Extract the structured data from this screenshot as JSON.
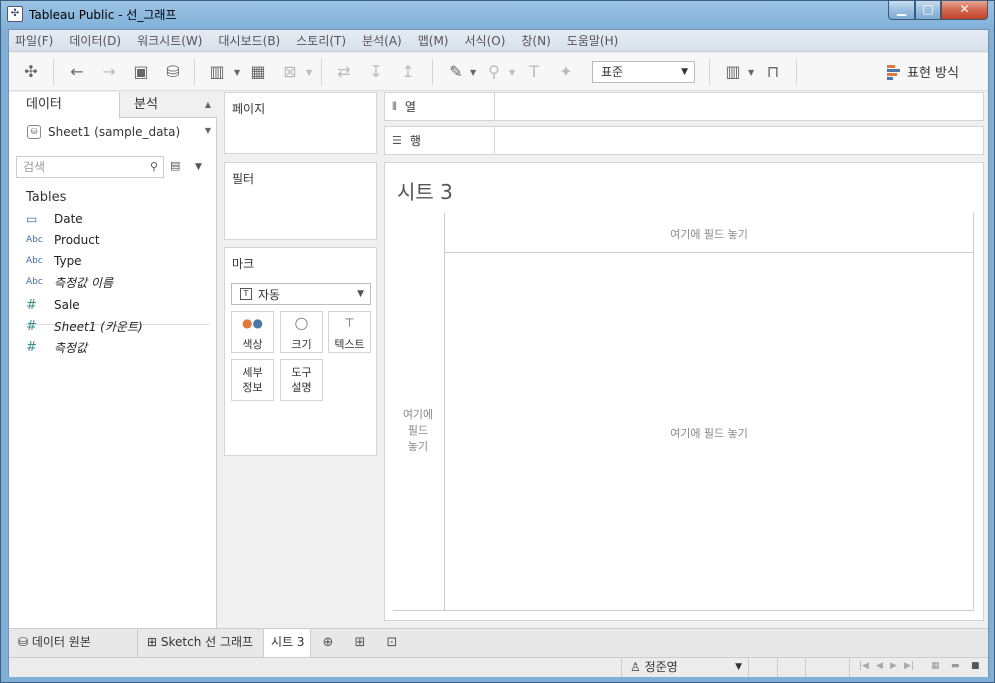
{
  "window": {
    "title": "Tableau Public - 선_그래프",
    "min": "▁",
    "max": "□",
    "close": "✕"
  },
  "menu": [
    "파일(F)",
    "데이터(D)",
    "워크시트(W)",
    "대시보드(B)",
    "스토리(T)",
    "분석(A)",
    "맵(M)",
    "서식(O)",
    "창(N)",
    "도움말(H)"
  ],
  "toolbar": {
    "format_value": "표준",
    "show_me": "표현 방식"
  },
  "data_pane": {
    "tab_data": "데이터",
    "tab_analysis": "분석",
    "source": "Sheet1 (sample_data)",
    "search_placeholder": "검색",
    "tables_header": "Tables",
    "dimensions": [
      {
        "type": "📅",
        "name": "Date"
      },
      {
        "type": "Abc",
        "name": "Product"
      },
      {
        "type": "Abc",
        "name": "Type"
      },
      {
        "type": "Abc",
        "name": "측정값 이름"
      }
    ],
    "measures": [
      {
        "type": "#",
        "name": "Sale"
      },
      {
        "type": "#",
        "name": "Sheet1 (카운트)"
      },
      {
        "type": "#",
        "name": "측정값"
      }
    ]
  },
  "cards": {
    "pages": "페이지",
    "filters": "필터",
    "marks": "마크",
    "marks_type": "자동",
    "color": "색상",
    "size": "크기",
    "text": "텍스트",
    "detail_1": "세부",
    "detail_2": "정보",
    "tooltip_1": "도구",
    "tooltip_2": "설명"
  },
  "shelves": {
    "columns": "열",
    "rows": "행"
  },
  "view": {
    "title": "시트 3",
    "drop_top": "여기에 필드 놓기",
    "drop_center": "여기에 필드 놓기",
    "drop_left_1": "여기에",
    "drop_left_2": "필드",
    "drop_left_3": "놓기"
  },
  "sheet_tabs": {
    "data_source": "데이터 원본",
    "sketch": "Sketch 선 그래프",
    "current": "시트 3"
  },
  "status": {
    "user": "정준영"
  }
}
